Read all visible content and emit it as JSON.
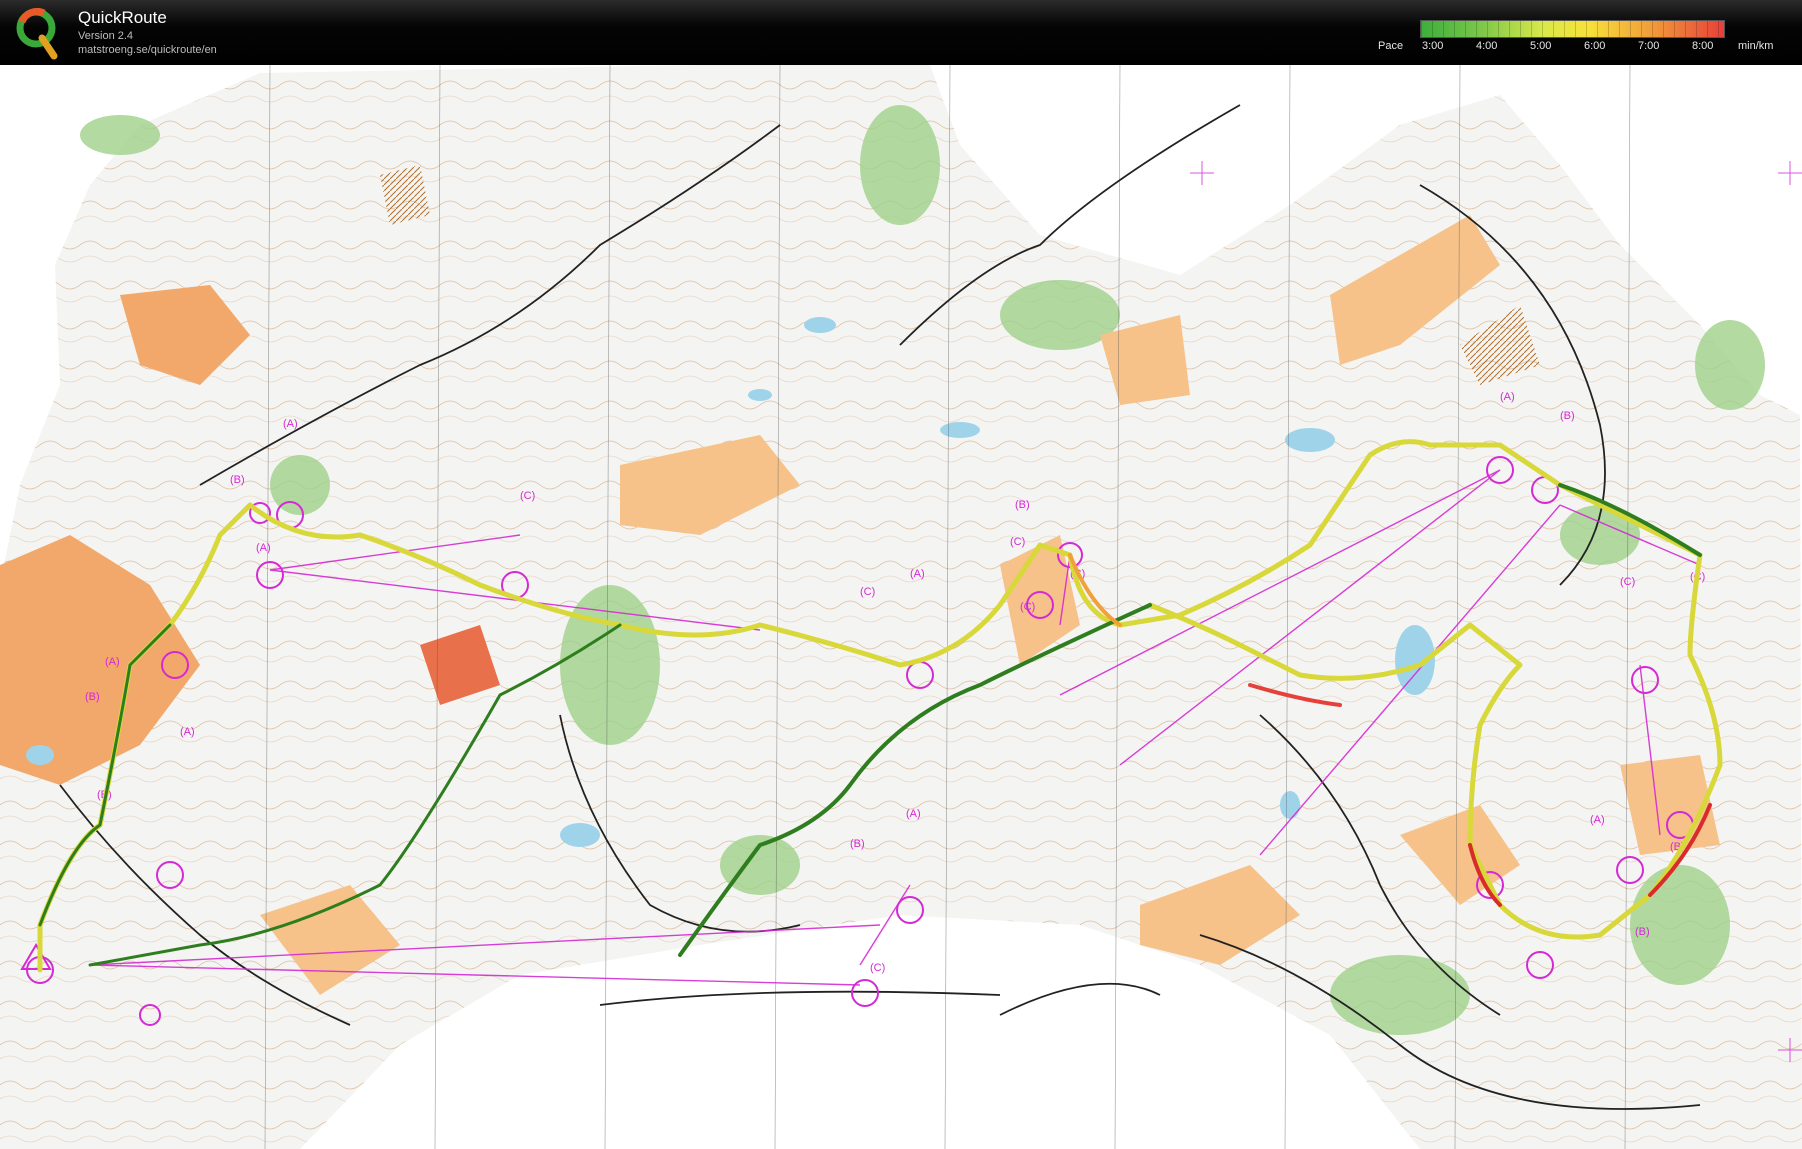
{
  "app": {
    "title": "QuickRoute",
    "version": "Version 2.4",
    "url": "matstroeng.se/quickroute/en"
  },
  "legend": {
    "label": "Pace",
    "ticks": [
      "3:00",
      "4:00",
      "5:00",
      "6:00",
      "7:00",
      "8:00"
    ],
    "unit": "min/km",
    "colors": [
      "#3cae3c",
      "#7cc84a",
      "#d9e84a",
      "#f6e23a",
      "#f2a03a",
      "#e6403a"
    ]
  },
  "map": {
    "control_labels": [
      "(A)",
      "(B)",
      "(C)",
      "(A)",
      "(B)",
      "(C)",
      "(A)",
      "(C)",
      "(A)",
      "(B)",
      "(C)",
      "(A)",
      "(B)",
      "(C)",
      "(A)",
      "(B)",
      "(C)",
      "(B)",
      "(A)",
      "(B)",
      "(C)",
      "(A)",
      "(B)",
      "(C)"
    ],
    "course_color": "#d42ad4",
    "route_colors": {
      "fast": "#2e7d1e",
      "medium": "#d8d83a",
      "slow": "#d92b2b"
    }
  }
}
